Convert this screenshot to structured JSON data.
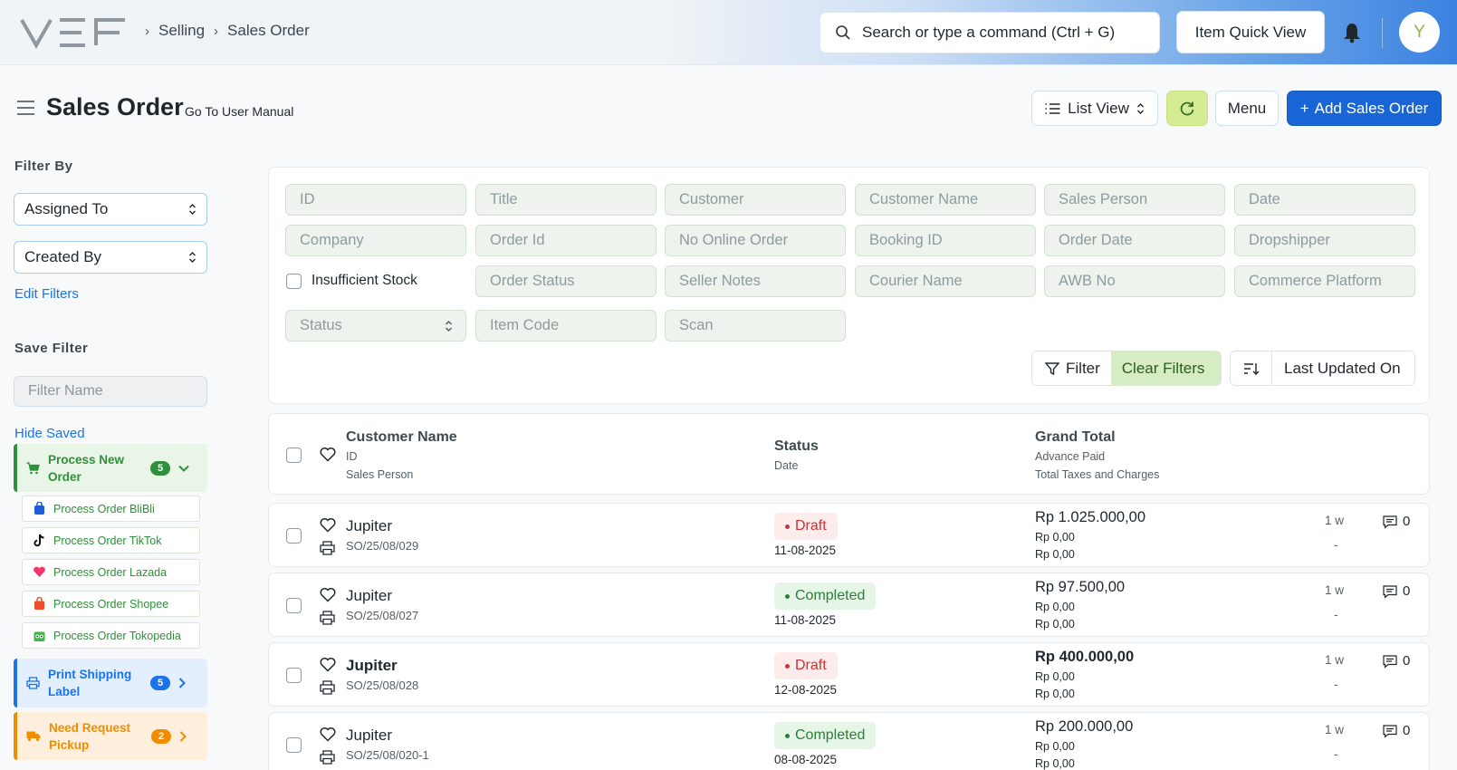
{
  "topbar": {
    "breadcrumbs": [
      "Selling",
      "Sales Order"
    ],
    "search_placeholder": "Search or type a command (Ctrl + G)",
    "item_quick_view": "Item Quick View",
    "avatar_letter": "Y"
  },
  "header": {
    "title": "Sales Order",
    "manual_link": "Go To User Manual",
    "list_view": "List View",
    "menu": "Menu",
    "add": "Add Sales Order"
  },
  "sidebar": {
    "filter_by": "Filter By",
    "assigned_to": "Assigned To",
    "created_by": "Created By",
    "edit_filters": "Edit Filters",
    "save_filter": "Save Filter",
    "filter_name_placeholder": "Filter Name",
    "hide_saved": "Hide Saved",
    "groups": [
      {
        "label": "Process New Order",
        "count": "5"
      },
      {
        "label": "Print Shipping Label",
        "count": "5"
      },
      {
        "label": "Need Request Pickup",
        "count": "2"
      }
    ],
    "sub_items": [
      "Process Order BliBli",
      "Process Order TikTok",
      "Process Order Lazada",
      "Process Order Shopee",
      "Process Order Tokopedia"
    ]
  },
  "filters": {
    "row1": [
      "ID",
      "Title",
      "Customer",
      "Customer Name",
      "Sales Person",
      "Date"
    ],
    "row2": [
      "Company",
      "Order Id",
      "No Online Order",
      "Booking ID",
      "Order Date",
      "Dropshipper"
    ],
    "insufficient_stock": "Insufficient Stock",
    "row3": [
      "Order Status",
      "Seller Notes",
      "Courier Name",
      "AWB No",
      "Commerce Platform"
    ],
    "status": "Status",
    "item_code": "Item Code",
    "scan": "Scan",
    "filter_btn": "Filter",
    "clear_btn": "Clear Filters",
    "sort_field": "Last Updated On"
  },
  "list": {
    "columns": {
      "customer_name": "Customer Name",
      "id": "ID",
      "sales_person": "Sales Person",
      "status": "Status",
      "date": "Date",
      "grand_total": "Grand Total",
      "advance_paid": "Advance Paid",
      "taxes": "Total Taxes and Charges"
    },
    "rows": [
      {
        "customer": "Jupiter",
        "id": "SO/25/08/029",
        "status": "Draft",
        "date": "11-08-2025",
        "total": "Rp 1.025.000,00",
        "advance": "Rp 0,00",
        "taxes": "Rp 0,00",
        "age": "1 w",
        "dash": "-",
        "comments": "0"
      },
      {
        "customer": "Jupiter",
        "id": "SO/25/08/027",
        "status": "Completed",
        "date": "11-08-2025",
        "total": "Rp 97.500,00",
        "advance": "Rp 0,00",
        "taxes": "Rp 0,00",
        "age": "1 w",
        "dash": "-",
        "comments": "0"
      },
      {
        "customer": "Jupiter",
        "id": "SO/25/08/028",
        "status": "Draft",
        "date": "12-08-2025",
        "total": "Rp 400.000,00",
        "advance": "Rp 0,00",
        "taxes": "Rp 0,00",
        "age": "1 w",
        "dash": "-",
        "comments": "0"
      },
      {
        "customer": "Jupiter",
        "id": "SO/25/08/020-1",
        "status": "Completed",
        "date": "08-08-2025",
        "total": "Rp 200.000,00",
        "advance": "Rp 0,00",
        "taxes": "Rp 0,00",
        "age": "1 w",
        "dash": "-",
        "comments": "0"
      }
    ]
  },
  "colors": {
    "primary": "#1866d6",
    "green_group": "#2f8f3a",
    "blue_group": "#1a73e8",
    "orange_group": "#f08c00"
  }
}
